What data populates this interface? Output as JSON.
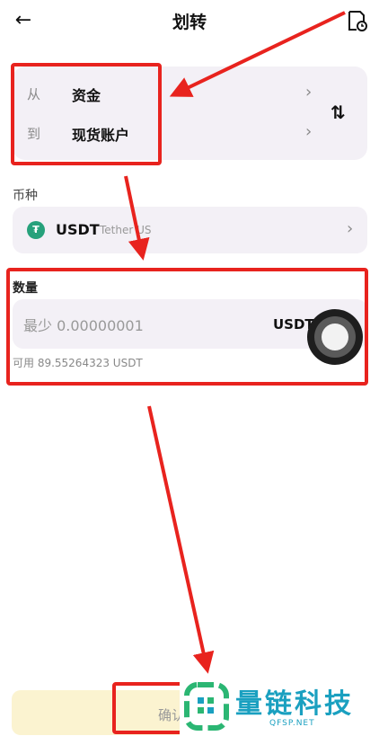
{
  "header": {
    "back_icon": "←",
    "title": "划转"
  },
  "transfer": {
    "from_label": "从",
    "from_value": "资金",
    "to_label": "到",
    "to_value": "现货账户",
    "chevron": "›",
    "swap_icon": "⇅"
  },
  "coin": {
    "section_title": "币种",
    "name": "USDT",
    "subtitle": "Tether US",
    "logo_glyph": "₮",
    "logo_color": "#26a17b"
  },
  "amount": {
    "section_title": "数量",
    "placeholder": "最少 0.00000001",
    "unit": "USDT",
    "available": "可用 89.55264323 USDT"
  },
  "footer": {
    "confirm_label": "确认"
  },
  "watermark": {
    "title": "量链科技",
    "url": "QFSP.NET"
  },
  "annotation_color": "#e8231e"
}
